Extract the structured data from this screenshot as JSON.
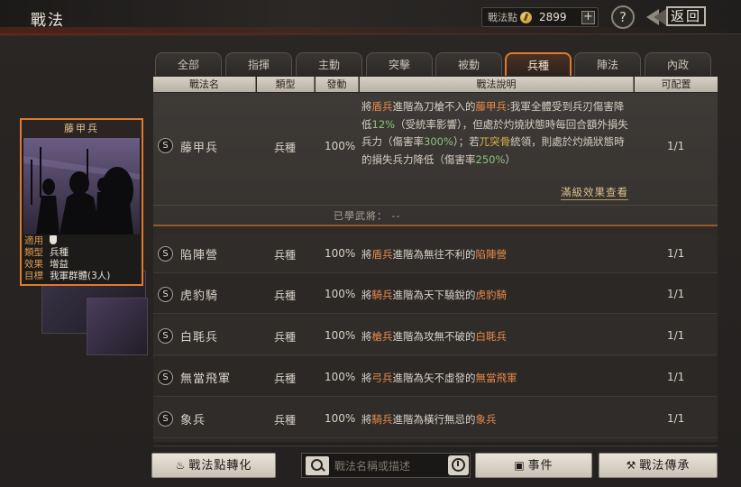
{
  "header": {
    "title": "戰法",
    "points_label": "戰法點",
    "points_value": "2899",
    "plus": "+",
    "help": "?",
    "back_label": "返回"
  },
  "tabs": [
    {
      "label": "全部"
    },
    {
      "label": "指揮"
    },
    {
      "label": "主動"
    },
    {
      "label": "突擊"
    },
    {
      "label": "被動"
    },
    {
      "label": "兵種",
      "active": true
    },
    {
      "label": "陣法"
    },
    {
      "label": "內政"
    }
  ],
  "columns": [
    "戰法名",
    "類型",
    "發動",
    "戰法說明",
    "可配置"
  ],
  "selected": {
    "badge": "S",
    "name": "藤甲兵",
    "type": "兵種",
    "rate": "100%",
    "desc": {
      "p1": "將",
      "p2": "盾兵",
      "p3": "進階為刀槍不入的",
      "p4": "藤甲兵",
      "p5": ":我軍全體受到兵刃傷害降低",
      "p6": "12%",
      "p7": "（受統率影響），但處於灼燒狀態時每回合額外損失兵力（傷害率",
      "p8": "300%",
      "p9": "）；若",
      "p10": "兀突骨",
      "p11": "統領，則處於灼燒狀態時的損失兵力降低（傷害率",
      "p12": "250%",
      "p13": "）"
    },
    "config": "1/1",
    "full_effect_link": "滿級效果查看",
    "learned_label": "已學武將：",
    "learned_value": "--"
  },
  "rows": [
    {
      "badge": "S",
      "name": "陷陣營",
      "type": "兵種",
      "rate": "100%",
      "d1": "將",
      "d2": "盾兵",
      "d3": "進階為無往不利的",
      "d4": "陷陣營",
      "config": "1/1"
    },
    {
      "badge": "S",
      "name": "虎豹騎",
      "type": "兵種",
      "rate": "100%",
      "d1": "將",
      "d2": "騎兵",
      "d3": "進階為天下驍銳的",
      "d4": "虎豹騎",
      "config": "1/1"
    },
    {
      "badge": "S",
      "name": "白毦兵",
      "type": "兵種",
      "rate": "100%",
      "d1": "將",
      "d2": "槍兵",
      "d3": "進階為攻無不破的",
      "d4": "白毦兵",
      "config": "1/1"
    },
    {
      "badge": "S",
      "name": "無當飛軍",
      "type": "兵種",
      "rate": "100%",
      "d1": "將",
      "d2": "弓兵",
      "d3": "進階為矢不虛發的",
      "d4": "無當飛軍",
      "config": "1/1"
    },
    {
      "badge": "S",
      "name": "象兵",
      "type": "兵種",
      "rate": "100%",
      "d1": "將",
      "d2": "騎兵",
      "d3": "進階為橫行無忌的",
      "d4": "象兵",
      "config": "1/1"
    }
  ],
  "card": {
    "title": "藤甲兵",
    "apply_label": "適用",
    "type_label": "類型",
    "type_value": "兵種",
    "effect_label": "效果",
    "effect_value": "增益",
    "target_label": "目標",
    "target_value": "我軍群體(3人)"
  },
  "bottom": {
    "convert_label": "戰法點轉化",
    "search_placeholder": "戰法名稱或描述",
    "event_label": "事件",
    "inherit_label": "戰法傳承"
  },
  "colors": {
    "accent": "#e0792e",
    "highlight_orange": "#e88a4a",
    "highlight_green": "#8fc37a",
    "highlight_yellow": "#d8b445"
  }
}
